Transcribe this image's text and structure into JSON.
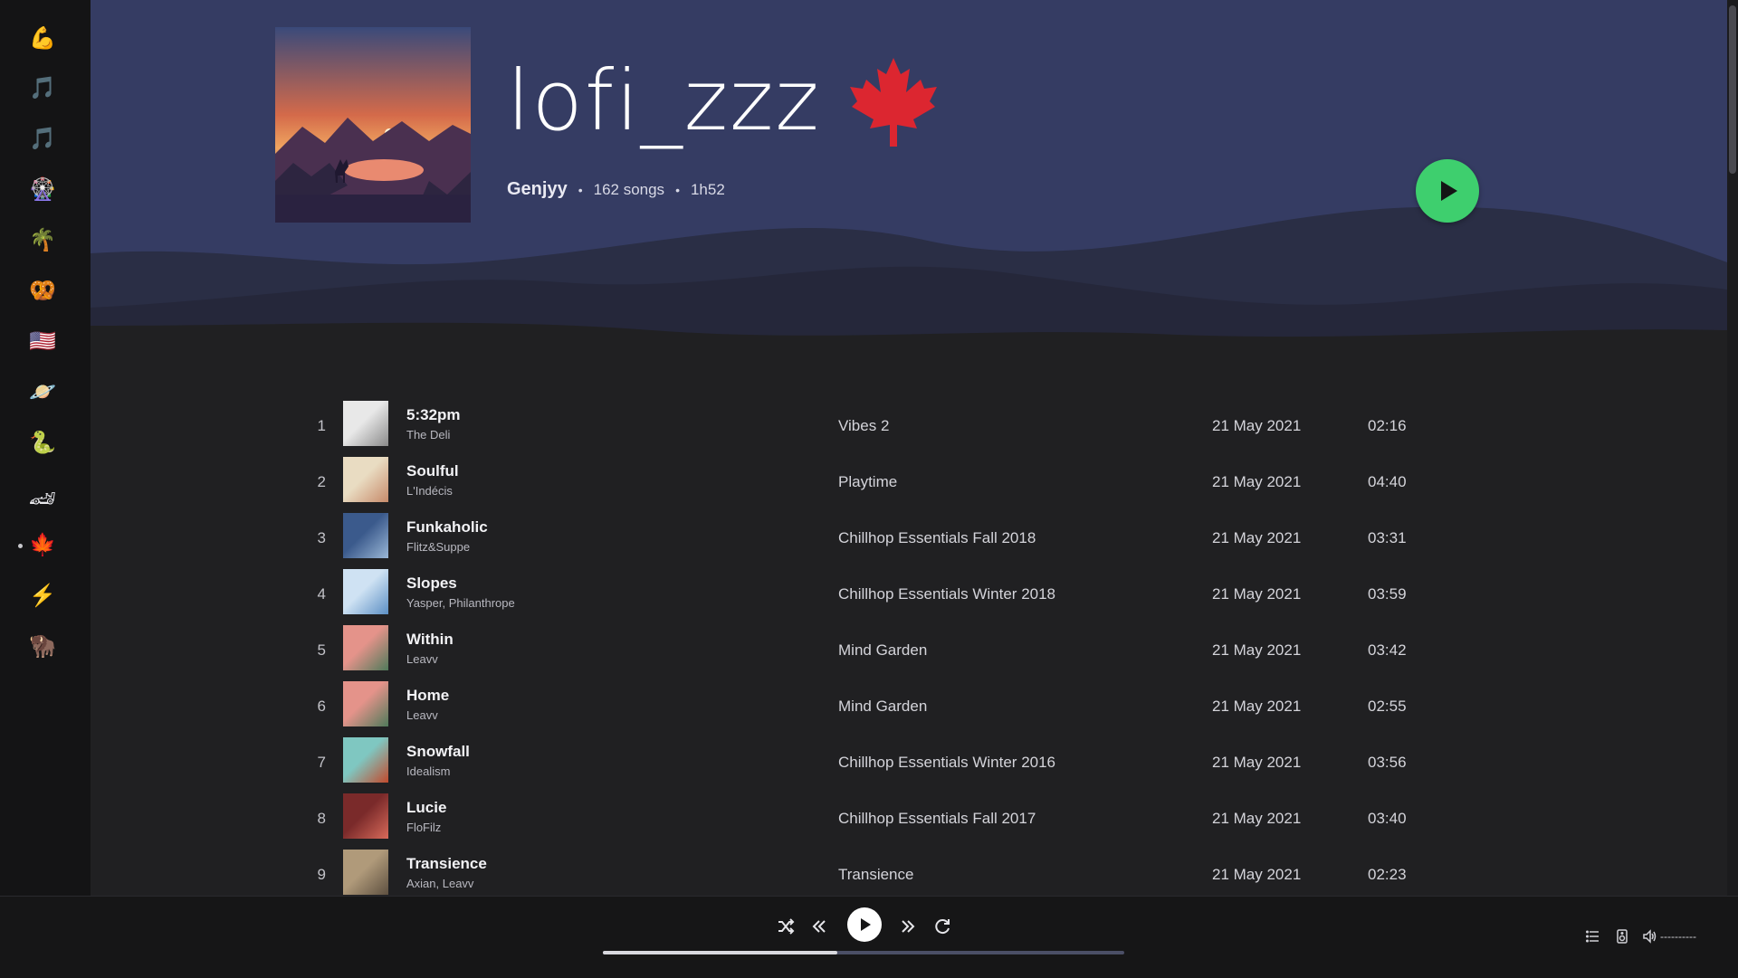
{
  "playlist": {
    "title": "lofi_zzz",
    "emoji": "🍁",
    "owner": "Genjyy",
    "songs": "162 songs",
    "duration": "1h52",
    "separator": "•"
  },
  "sidebar": {
    "items": [
      {
        "name": "biceps-icon",
        "glyph": "💪"
      },
      {
        "name": "music-note-icon",
        "glyph": "🎵"
      },
      {
        "name": "music-note-icon",
        "glyph": "🎵"
      },
      {
        "name": "ferris-wheel-icon",
        "glyph": "🎡"
      },
      {
        "name": "palm-tree-icon",
        "glyph": "🌴"
      },
      {
        "name": "pretzel-icon",
        "glyph": "🥨"
      },
      {
        "name": "us-flag-icon",
        "glyph": "🇺🇸"
      },
      {
        "name": "planet-icon",
        "glyph": "🪐"
      },
      {
        "name": "snake-icon",
        "glyph": "🐍"
      },
      {
        "name": "race-car-icon",
        "glyph": "🏎"
      },
      {
        "name": "maple-leaf-icon",
        "glyph": "🍁",
        "active": true
      },
      {
        "name": "lightning-icon",
        "glyph": "⚡"
      },
      {
        "name": "bison-icon",
        "glyph": "🦬"
      }
    ]
  },
  "tracks": [
    {
      "num": "1",
      "title": "5:32pm",
      "artist": "The Deli",
      "album": "Vibes 2",
      "date": "21 May 2021",
      "duration": "02:16",
      "art": [
        "#e8e8e8",
        "#8a8a8a"
      ]
    },
    {
      "num": "2",
      "title": "Soulful",
      "artist": "L'Indécis",
      "album": "Playtime",
      "date": "21 May 2021",
      "duration": "04:40",
      "art": [
        "#e9dcc2",
        "#c78a6a"
      ]
    },
    {
      "num": "3",
      "title": "Funkaholic",
      "artist": "Flitz&Suppe",
      "album": "Chillhop Essentials Fall 2018",
      "date": "21 May 2021",
      "duration": "03:31",
      "art": [
        "#3b5a8c",
        "#9ab7d6"
      ]
    },
    {
      "num": "4",
      "title": "Slopes",
      "artist": "Yasper, Philanthrope",
      "album": "Chillhop Essentials Winter 2018",
      "date": "21 May 2021",
      "duration": "03:59",
      "art": [
        "#cfe2f3",
        "#5c8fc4"
      ]
    },
    {
      "num": "5",
      "title": "Within",
      "artist": "Leavv",
      "album": "Mind Garden",
      "date": "21 May 2021",
      "duration": "03:42",
      "art": [
        "#e4938a",
        "#4f7a5a"
      ]
    },
    {
      "num": "6",
      "title": "Home",
      "artist": "Leavv",
      "album": "Mind Garden",
      "date": "21 May 2021",
      "duration": "02:55",
      "art": [
        "#e4938a",
        "#4f7a5a"
      ]
    },
    {
      "num": "7",
      "title": "Snowfall",
      "artist": "Idealism",
      "album": "Chillhop Essentials Winter 2016",
      "date": "21 May 2021",
      "duration": "03:56",
      "art": [
        "#7fc7c1",
        "#c24a2c"
      ]
    },
    {
      "num": "8",
      "title": "Lucie",
      "artist": "FloFilz",
      "album": "Chillhop Essentials Fall 2017",
      "date": "21 May 2021",
      "duration": "03:40",
      "art": [
        "#7a2a2a",
        "#d86a5a"
      ]
    },
    {
      "num": "9",
      "title": "Transience",
      "artist": "Axian, Leavv",
      "album": "Transience",
      "date": "21 May 2021",
      "duration": "02:23",
      "art": [
        "#b09a7a",
        "#5e5040"
      ]
    }
  ],
  "player": {
    "progress": 0.45,
    "volume_text": "----------"
  },
  "colors": {
    "header": "#353c63",
    "accent": "#3ecf6e",
    "background": "#202022"
  }
}
